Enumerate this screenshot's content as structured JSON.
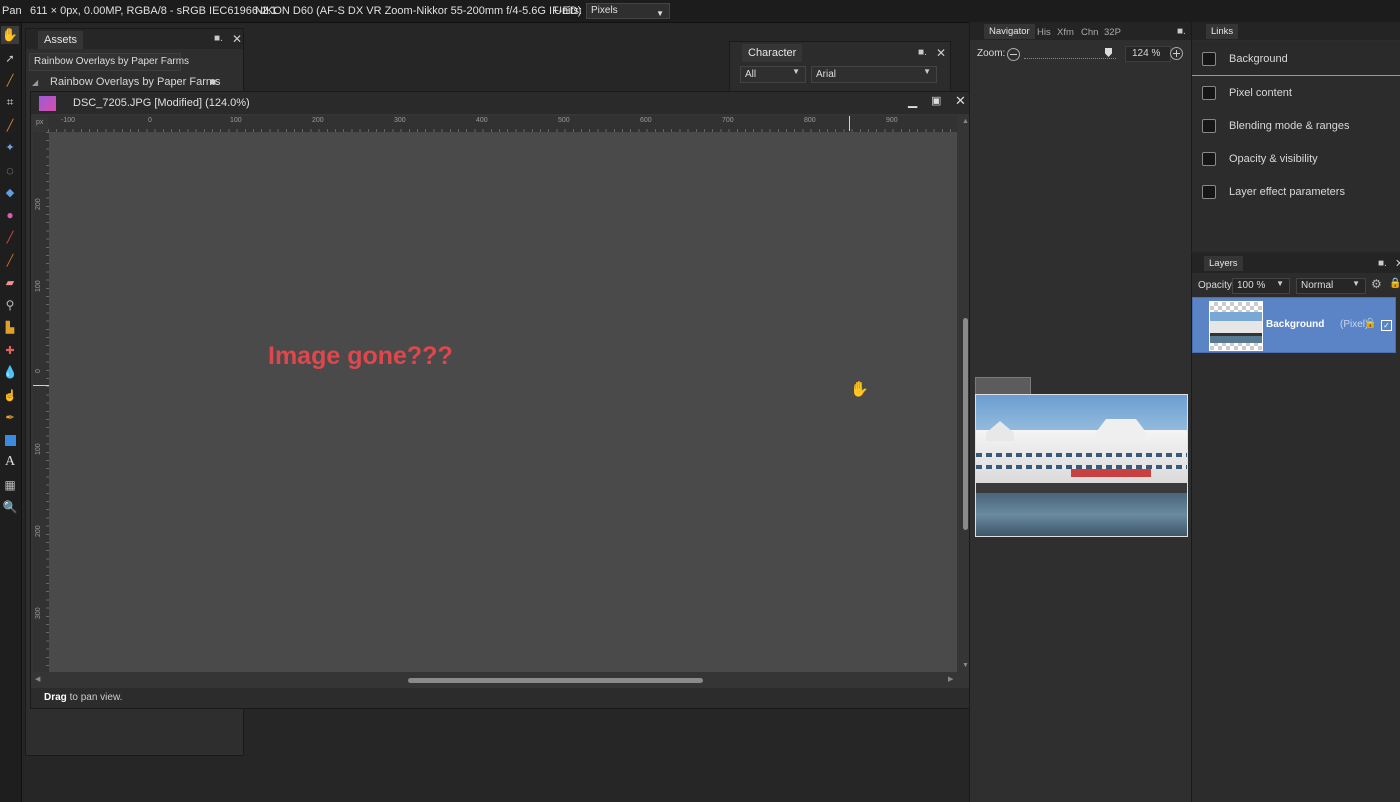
{
  "context_bar": {
    "tool_name": "Pan",
    "doc_info": "611 × 0px, 0.00MP, RGBA/8 - sRGB IEC61966-2.1",
    "camera_info": "NIKON D60 (AF-S DX VR Zoom-Nikkor 55-200mm f/4-5.6G IF-ED)",
    "units_label": "Units:",
    "units_value": "Pixels"
  },
  "toolbar": {
    "tools": [
      "hand-icon",
      "move-icon",
      "color-picker-icon",
      "crop-icon",
      "paint-brush-icon",
      "selection-brush-icon",
      "marquee-icon",
      "flood-fill-icon",
      "gradient-icon",
      "brush-icon",
      "color-replace-icon",
      "eraser-icon",
      "dodge-icon",
      "clone-icon",
      "healing-icon",
      "blur-icon",
      "smudge-icon",
      "pen-icon",
      "rectangle-icon",
      "text-icon",
      "mesh-icon",
      "zoom-icon"
    ]
  },
  "assets_panel": {
    "tab": "Assets",
    "category": "Rainbow Overlays by Paper Farms",
    "group": "Rainbow Overlays by Paper Farms"
  },
  "character_panel": {
    "tab": "Character",
    "filter": "All",
    "font": "Arial"
  },
  "document": {
    "title": "DSC_7205.JPG [Modified] (124.0%)",
    "ruler_unit": "px",
    "h_ruler": [
      "-100",
      "0",
      "100",
      "200",
      "300",
      "400",
      "500",
      "600",
      "700",
      "800",
      "900"
    ],
    "v_ruler": [
      "200",
      "100",
      "0",
      "100",
      "200",
      "300"
    ],
    "annotation": "Image gone???",
    "status_bold": "Drag",
    "status_rest": " to pan view."
  },
  "navigator": {
    "tabs": [
      "Navigator",
      "His",
      "Xfm",
      "Chn",
      "32P"
    ],
    "zoom_label": "Zoom:",
    "zoom_value": "124 %"
  },
  "links_panel": {
    "tab": "Links",
    "items": [
      "Background",
      "Pixel content",
      "Blending mode & ranges",
      "Opacity & visibility",
      "Layer effect parameters"
    ]
  },
  "layers_panel": {
    "tab": "Layers",
    "opacity_label": "Opacity:",
    "opacity_value": "100 %",
    "blend_mode": "Normal",
    "layer_name": "Background",
    "layer_type": "(Pixel)"
  },
  "colors": {
    "accent": "#5b84c7",
    "annotation": "#e0474c",
    "canvas_bg": "#4a4a4a"
  }
}
